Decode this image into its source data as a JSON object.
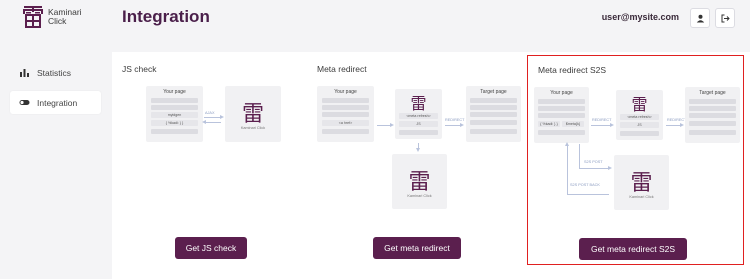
{
  "app": {
    "logo_line1": "Kaminari",
    "logo_line2": "Click"
  },
  "sidebar": {
    "items": [
      {
        "label": "Statistics",
        "icon": "bar-chart-icon",
        "active": false
      },
      {
        "label": "Integration",
        "icon": "toggle-icon",
        "active": true
      }
    ]
  },
  "header": {
    "title": "Integration",
    "user_email": "user@mysite.com",
    "profile_icon": "user-icon",
    "logout_icon": "logout-icon"
  },
  "panels": {
    "js_check": {
      "title": "JS check",
      "button": "Get JS check",
      "your_page": "Your page",
      "field1": "myidgen",
      "field2": "{ %kadi: } }",
      "arrow_label": "AJAX",
      "brand_caption": "Kaminari Click"
    },
    "meta_redirect": {
      "title": "Meta redirect",
      "button": "Get meta redirect",
      "your_page": "Your page",
      "field1": "<a href>",
      "redirect_field1": "<meta refresh>",
      "redirect_field2": "JS",
      "arrow_label": "REDIRECT",
      "target_page": "Target page",
      "brand_caption": "Kaminari Click"
    },
    "meta_redirect_s2s": {
      "title": "Meta redirect S2S",
      "button": "Get meta redirect S2S",
      "your_page": "Your page",
      "field_a": "{ %kadi: } }",
      "field_b": "$meta{k}",
      "arrow_label": "REDIRECT",
      "redirect_field1": "<meta refresh>",
      "redirect_field2": "JS",
      "arrow_label2": "REDIRECT",
      "target_page": "Target page",
      "s2s_label": "S2S POST",
      "s2s_back_label": "S2S POST BACK",
      "brand_caption": "Kaminari Click"
    }
  },
  "colors": {
    "brand": "#5b1f4e",
    "selected_border": "#e02020",
    "background": "#f4f4f6"
  }
}
